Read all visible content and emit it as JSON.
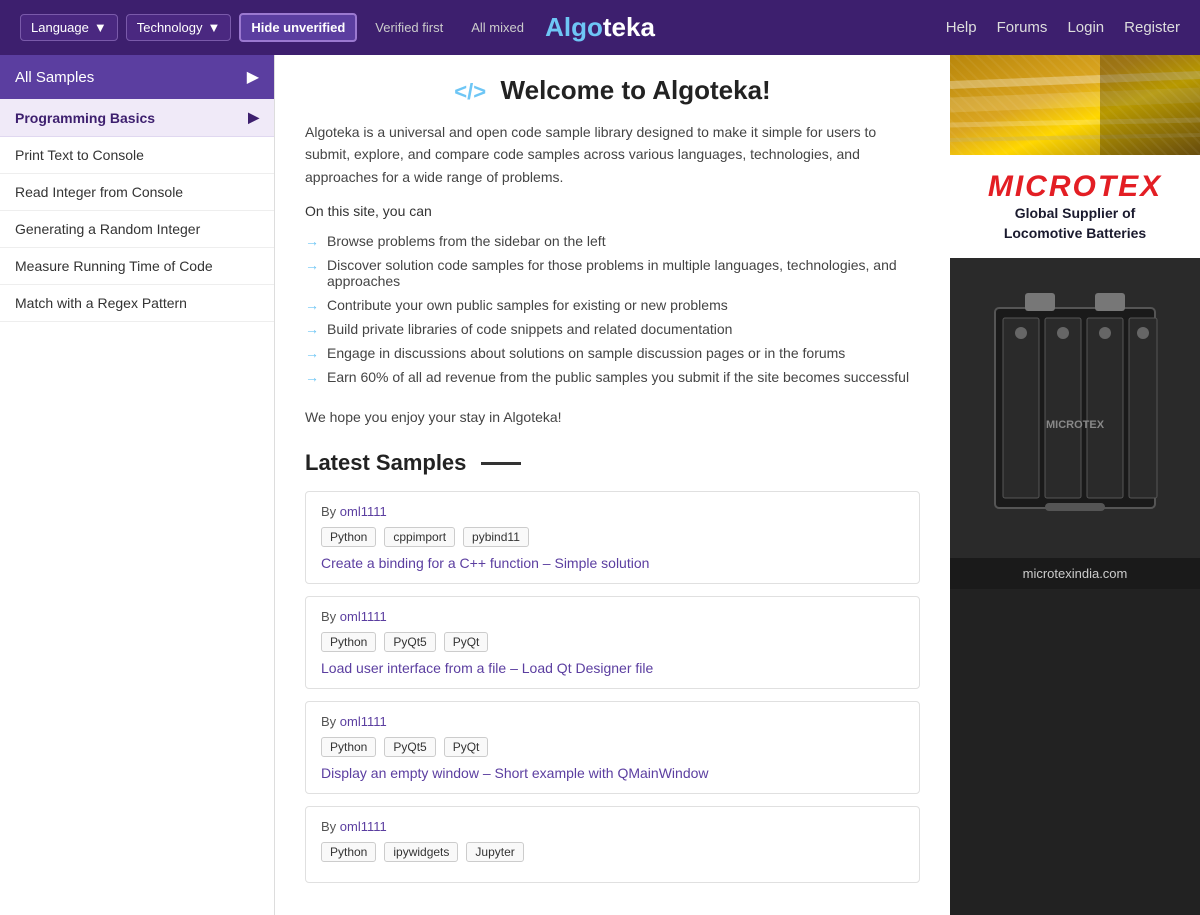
{
  "header": {
    "logo_algo": "Algo",
    "logo_teka": "teka",
    "language_btn": "Language",
    "technology_btn": "Technology",
    "hide_unverified_btn": "Hide unverified",
    "verified_first_btn": "Verified first",
    "all_mixed_btn": "All mixed",
    "nav": {
      "help": "Help",
      "forums": "Forums",
      "login": "Login",
      "register": "Register"
    }
  },
  "sidebar": {
    "all_samples": "All Samples",
    "section": "Programming Basics",
    "items": [
      "Print Text to Console",
      "Read Integer from Console",
      "Generating a Random Integer",
      "Measure Running Time of Code",
      "Match with a Regex Pattern"
    ]
  },
  "welcome": {
    "title": "Welcome to Algoteka!",
    "bracket_open": "</>",
    "description": "Algoteka is a universal and open code sample library designed to make it simple for users to submit, explore, and compare code samples across various languages, technologies, and approaches for a wide range of problems.",
    "on_this_site": "On this site, you can",
    "features": [
      "Browse problems from the sidebar on the left",
      "Discover solution code samples for those problems in multiple languages, technologies, and approaches",
      "Contribute your own public samples for existing or new problems",
      "Build private libraries of code snippets and related documentation",
      "Engage in discussions about solutions on sample discussion pages or in the forums",
      "Earn 60% of all ad revenue from the public samples you submit if the site becomes successful"
    ],
    "hope_text": "We hope you enjoy your stay in Algoteka!"
  },
  "latest_samples": {
    "title": "Latest Samples",
    "samples": [
      {
        "by_label": "By",
        "author": "oml1111",
        "tags": [
          "Python",
          "cppimport",
          "pybind11"
        ],
        "link_text": "Create a binding for a C++ function – Simple solution"
      },
      {
        "by_label": "By",
        "author": "oml1111",
        "tags": [
          "Python",
          "PyQt5",
          "PyQt"
        ],
        "link_text": "Load user interface from a file – Load Qt Designer file"
      },
      {
        "by_label": "By",
        "author": "oml1111",
        "tags": [
          "Python",
          "PyQt5",
          "PyQt"
        ],
        "link_text": "Display an empty window – Short example with QMainWindow"
      },
      {
        "by_label": "By",
        "author": "oml1111",
        "tags": [
          "Python",
          "ipywidgets",
          "Jupyter"
        ],
        "link_text": ""
      }
    ]
  },
  "ad": {
    "brand": "MICROTEX",
    "tagline": "Global Supplier of\nLocomotive Batteries",
    "website": "microtexindia.com"
  }
}
